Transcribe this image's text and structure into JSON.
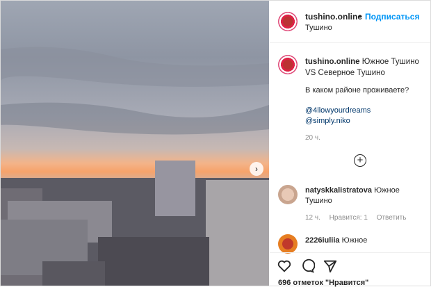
{
  "post": {
    "username": "tushino.online",
    "dot": "•",
    "follow_label": "Подписаться",
    "location": "Тушино",
    "caption_text": "Южное Тушино VS Северное Тушино",
    "question": "В каком районе проживаете?",
    "mention1_icon": "",
    "mention1": "@4llowyourdreams",
    "mention2_icon": "",
    "mention2": "@simply.niko",
    "time": "20 ч."
  },
  "comments": [
    {
      "username": "natyskkalistratova",
      "text": "Южное Тушино",
      "emoji": "",
      "time": "12 ч.",
      "likes": "Нравится: 1",
      "reply": "Ответить"
    },
    {
      "username": "2226iuliia",
      "text": "Южное"
    }
  ],
  "actions": {
    "likes": "696 отметок \"Нравится\""
  },
  "icons": {
    "next": "chevron-right-icon",
    "more": "plus-circle-icon",
    "like": "heart-icon",
    "comment": "comment-icon",
    "share": "share-icon"
  },
  "colors": {
    "accent": "#0095f6",
    "text": "#262626",
    "muted": "#8e8e8e"
  }
}
